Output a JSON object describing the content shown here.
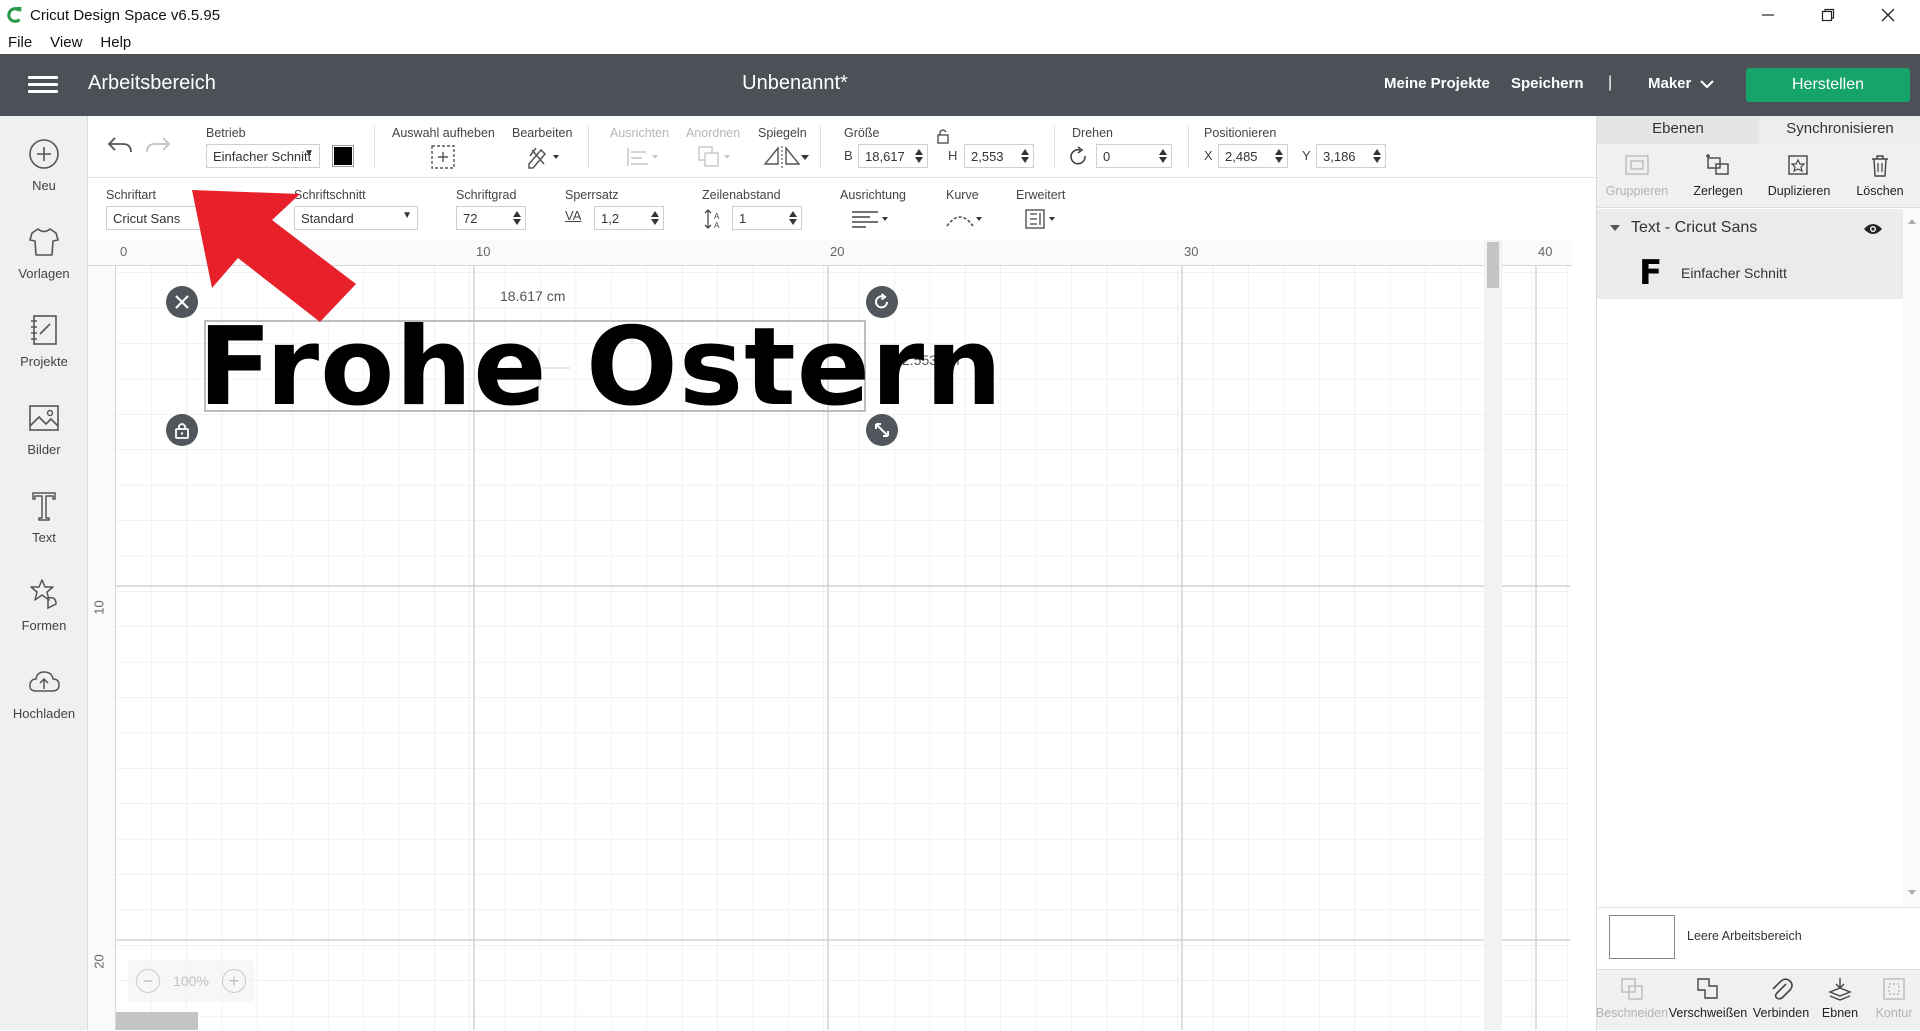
{
  "window": {
    "title": "Cricut Design Space  v6.5.95",
    "menu": [
      "File",
      "View",
      "Help"
    ]
  },
  "header": {
    "workspace": "Arbeitsbereich",
    "project_name": "Unbenannt*",
    "my_projects": "Meine Projekte",
    "save": "Speichern",
    "separator": "|",
    "machine": "Maker",
    "make_button": "Herstellen",
    "make_color": "#17a46b",
    "header_color": "#4b5156"
  },
  "sidebar": {
    "items": [
      {
        "label": "Neu",
        "icon": "plus-circle-icon"
      },
      {
        "label": "Vorlagen",
        "icon": "tshirt-icon"
      },
      {
        "label": "Projekte",
        "icon": "notebook-icon"
      },
      {
        "label": "Bilder",
        "icon": "image-icon"
      },
      {
        "label": "Text",
        "icon": "text-t-icon"
      },
      {
        "label": "Formen",
        "icon": "shapes-icon"
      },
      {
        "label": "Hochladen",
        "icon": "cloud-upload-icon"
      }
    ]
  },
  "toolbar1": {
    "operation_label": "Betrieb",
    "operation_value": "Einfacher Schnitt",
    "color_swatch": "#000000",
    "deselect_label": "Auswahl aufheben",
    "edit_label": "Bearbeiten",
    "align_label": "Ausrichten",
    "arrange_label": "Anordnen",
    "flip_label": "Spiegeln",
    "size_label": "Größe",
    "width_prefix": "B",
    "width_value": "18,617",
    "height_prefix": "H",
    "height_value": "2,553",
    "rotate_label": "Drehen",
    "rotate_value": "0",
    "position_label": "Positionieren",
    "x_prefix": "X",
    "x_value": "2,485",
    "y_prefix": "Y",
    "y_value": "3,186"
  },
  "toolbar2": {
    "font_label": "Schriftart",
    "font_value": "Cricut Sans",
    "style_label": "Schriftschnitt",
    "style_value": "Standard",
    "size_label": "Schriftgrad",
    "size_value": "72",
    "spacing_label": "Sperrsatz",
    "spacing_prefix": "VA",
    "spacing_value": "1,2",
    "line_label": "Zeilenabstand",
    "line_value": "1",
    "alignment_label": "Ausrichtung",
    "curve_label": "Kurve",
    "advanced_label": "Erweitert"
  },
  "canvas": {
    "ruler_top": [
      "0",
      "10",
      "20",
      "30",
      "40"
    ],
    "ruler_left": [
      "10",
      "20"
    ],
    "text_object": "Frohe Ostern",
    "width_dim": "18.617 cm",
    "height_dim": "2.553 cm",
    "zoom": "100%"
  },
  "rightpanel": {
    "tab_layers": "Ebenen",
    "tab_sync": "Synchronisieren",
    "actions": [
      {
        "label": "Gruppieren",
        "disabled": true,
        "icon": "group-icon"
      },
      {
        "label": "Zerlegen",
        "disabled": false,
        "icon": "ungroup-icon"
      },
      {
        "label": "Duplizieren",
        "disabled": false,
        "icon": "duplicate-icon"
      },
      {
        "label": "Löschen",
        "disabled": false,
        "icon": "trash-icon"
      }
    ],
    "layer_group": "Text - Cricut Sans",
    "layer_glyph": "F",
    "layer_operation": "Einfacher Schnitt",
    "blank_canvas": "Leere Arbeitsbereich",
    "bottom": [
      {
        "label": "Beschneiden",
        "disabled": true,
        "icon": "slice-icon"
      },
      {
        "label": "Verschweißen",
        "disabled": false,
        "icon": "weld-icon"
      },
      {
        "label": "Verbinden",
        "disabled": false,
        "icon": "attach-icon"
      },
      {
        "label": "Ebnen",
        "disabled": false,
        "icon": "flatten-icon"
      },
      {
        "label": "Kontur",
        "disabled": true,
        "icon": "contour-icon"
      }
    ]
  }
}
